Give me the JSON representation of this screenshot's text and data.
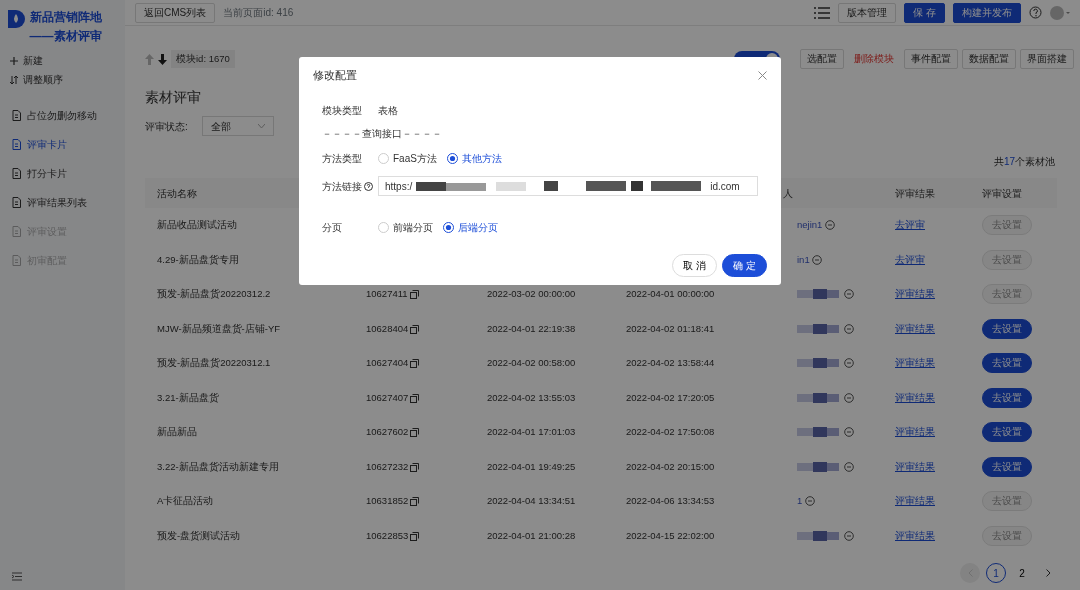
{
  "sidebar": {
    "logo_lines": [
      "新品营销阵地",
      "——素材评审"
    ],
    "actions": [
      {
        "label": "新建",
        "kind": "plus"
      },
      {
        "label": "调整顺序",
        "kind": "sort"
      }
    ],
    "items": [
      {
        "label": "占位勿删勿移动",
        "selected": false,
        "disabled": false
      },
      {
        "label": "评审卡片",
        "selected": true,
        "disabled": false
      },
      {
        "label": "打分卡片",
        "selected": false,
        "disabled": false
      },
      {
        "label": "评审结果列表",
        "selected": false,
        "disabled": false
      },
      {
        "label": "评审设置",
        "selected": false,
        "disabled": true
      },
      {
        "label": "初审配置",
        "selected": false,
        "disabled": true
      }
    ]
  },
  "topbar": {
    "back_button": "返回CMS列表",
    "page_id": "当前页面id: 416",
    "buttons": [
      {
        "label": "版本管理",
        "kind": "default"
      },
      {
        "label": "保 存",
        "kind": "primary"
      },
      {
        "label": "构建并发布",
        "kind": "primary"
      }
    ]
  },
  "module_bar": {
    "move_up_disabled": true,
    "move_down_disabled": false,
    "module_id": "模块id: 1670",
    "switch_on": true,
    "actions": [
      {
        "label": "选配置",
        "kind": "default"
      },
      {
        "label": "删除模块",
        "kind": "danger"
      },
      {
        "label": "事件配置",
        "kind": "default"
      },
      {
        "label": "数据配置",
        "kind": "default"
      },
      {
        "label": "界面搭建",
        "kind": "default"
      }
    ]
  },
  "section": {
    "title": "素材评审",
    "filter_label": "评审状态:",
    "filter_value": "全部",
    "total_prefix": "共",
    "total_count": "17",
    "total_suffix": "个素材池"
  },
  "table": {
    "columns": [
      {
        "label": "活动名称"
      },
      {},
      {},
      {},
      {
        "label": "人"
      },
      {
        "label": "评审结果"
      },
      {
        "label": "评审设置"
      }
    ],
    "rows": [
      {
        "name": "新品收品测试活动",
        "person": "nejin1",
        "result": "去评审",
        "setting": "去设置",
        "setting_enabled": false
      },
      {
        "name": "4.29-新品盘货专用",
        "person": "in1",
        "result": "去评审",
        "setting": "去设置",
        "setting_enabled": false
      },
      {
        "name": "预发-新品盘货20220312.2",
        "id": "10627411",
        "start": "2022-03-02 00:00:00",
        "end": "2022-04-01 00:00:00",
        "result": "评审结果",
        "setting": "去设置",
        "setting_enabled": false
      },
      {
        "name": "MJW-新品频道盘货-店铺-YF",
        "id": "10628404",
        "start": "2022-04-01 22:19:38",
        "end": "2022-04-02 01:18:41",
        "result": "评审结果",
        "setting": "去设置",
        "setting_enabled": true
      },
      {
        "name": "预发-新品盘货20220312.1",
        "id": "10627404",
        "start": "2022-04-02 00:58:00",
        "end": "2022-04-02 13:58:44",
        "result": "评审结果",
        "setting": "去设置",
        "setting_enabled": true
      },
      {
        "name": "3.21-新品盘货",
        "id": "10627407",
        "start": "2022-04-02 13:55:03",
        "end": "2022-04-02 17:20:05",
        "result": "评审结果",
        "setting": "去设置",
        "setting_enabled": true
      },
      {
        "name": "新品新品",
        "id": "10627602",
        "start": "2022-04-01 17:01:03",
        "end": "2022-04-02 17:50:08",
        "result": "评审结果",
        "setting": "去设置",
        "setting_enabled": true
      },
      {
        "name": "3.22-新品盘货活动新建专用",
        "id": "10627232",
        "start": "2022-04-01 19:49:25",
        "end": "2022-04-02 20:15:00",
        "result": "评审结果",
        "setting": "去设置",
        "setting_enabled": true
      },
      {
        "name": "A卡征品活动",
        "id": "10631852",
        "start": "2022-04-04 13:34:51",
        "end": "2022-04-06 13:34:53",
        "person": "1",
        "result": "评审结果",
        "setting": "去设置",
        "setting_enabled": false
      },
      {
        "name": "预发-盘货测试活动",
        "id": "10622853",
        "start": "2022-04-01 21:00:28",
        "end": "2022-04-15 22:02:00",
        "result": "评审结果",
        "setting": "去设置",
        "setting_enabled": false
      }
    ]
  },
  "pagination": {
    "prev_disabled": true,
    "next_disabled": false,
    "pages": [
      {
        "label": "1",
        "selected": true
      },
      {
        "label": "2",
        "selected": false
      }
    ]
  },
  "modal": {
    "title": "修改配置",
    "fields": [
      {
        "kind": "text",
        "label": "模块类型",
        "value": "表格"
      },
      {
        "kind": "divider",
        "label": "－－－－查询接口－－－－"
      },
      {
        "kind": "radio",
        "label": "方法类型",
        "options": [
          {
            "label": "FaaS方法",
            "selected": false
          },
          {
            "label": "其他方法",
            "selected": true
          }
        ]
      },
      {
        "kind": "url",
        "label": "方法链接",
        "help": true,
        "value_start": "https:/",
        "value_end": "id.com"
      },
      {
        "kind": "radio",
        "label": "分页",
        "options": [
          {
            "label": "前端分页",
            "selected": false
          },
          {
            "label": "后端分页",
            "selected": true
          }
        ]
      }
    ],
    "buttons": [
      {
        "label": "取 消",
        "kind": "default"
      },
      {
        "label": "确 定",
        "kind": "primary"
      }
    ]
  }
}
